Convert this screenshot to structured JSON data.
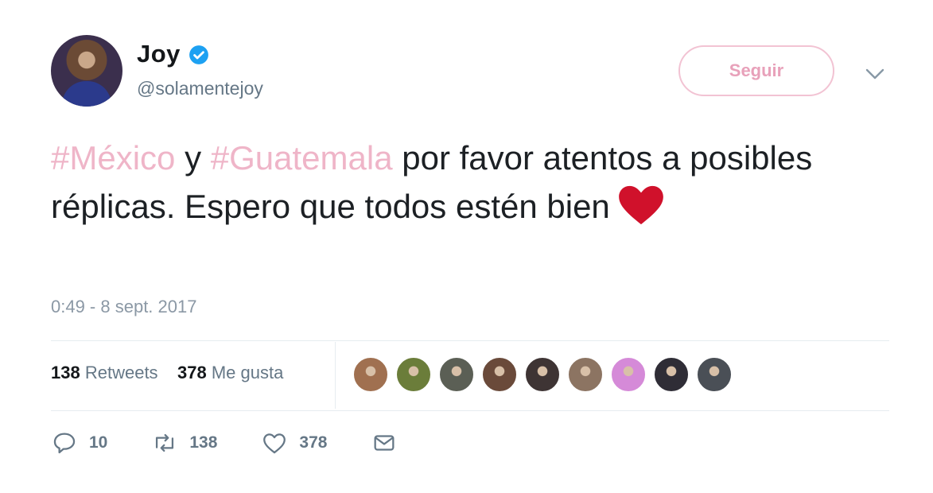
{
  "user": {
    "name": "Joy",
    "handle": "@solamentejoy",
    "verified_color": "#1da1f2"
  },
  "follow_button": {
    "label": "Seguir"
  },
  "tweet": {
    "hashtag1": "#México",
    "connector": " y ",
    "hashtag2": "#Guatemala",
    "text": " por favor atentos a posibles réplicas. Espero que todos estén bien",
    "emoji": "red-heart"
  },
  "timestamp": "0:49 - 8 sept. 2017",
  "stats": {
    "retweets_count": "138",
    "retweets_label": "Retweets",
    "likes_count": "378",
    "likes_label": "Me gusta"
  },
  "likers_colors": [
    "#a07050",
    "#6b7d3a",
    "#5b5f55",
    "#6a4a3a",
    "#3e3434",
    "#8c7462",
    "#d58ad8",
    "#2f2d36",
    "#4a4f56"
  ],
  "actions": {
    "reply_count": "10",
    "retweet_count": "138",
    "like_count": "378"
  },
  "colors": {
    "hashtag": "#efb5c8",
    "follow_border": "#f2c3d3",
    "heart": "#d0112b"
  }
}
